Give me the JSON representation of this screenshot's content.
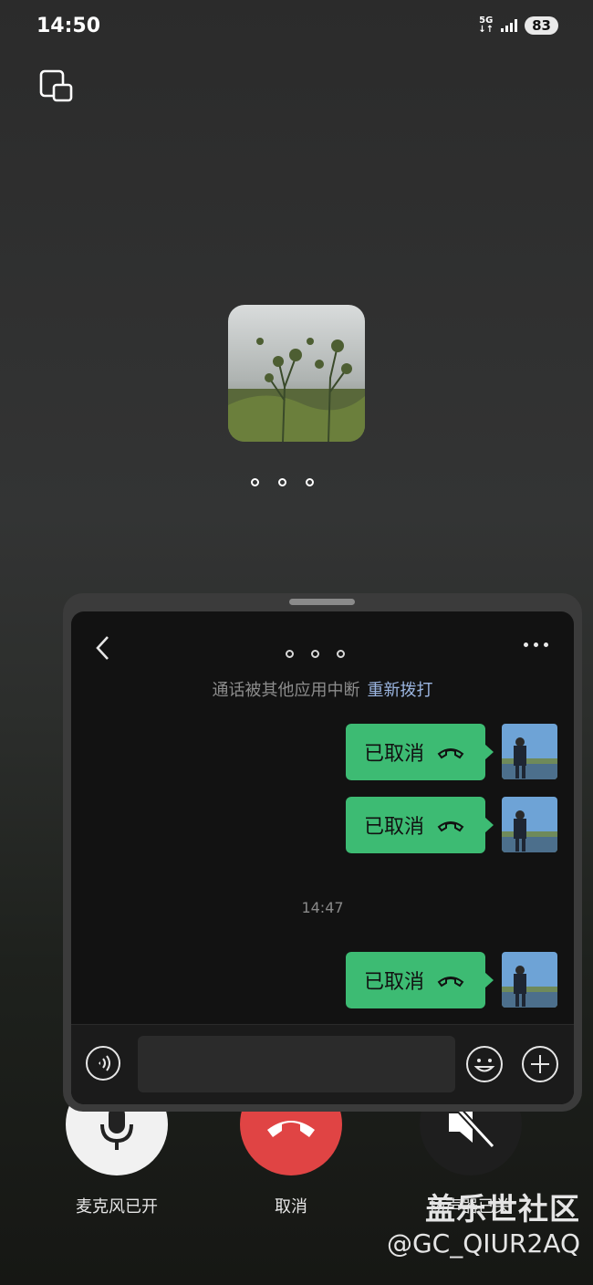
{
  "status_bar": {
    "time": "14:50",
    "network": "5G",
    "battery": "83"
  },
  "call": {
    "status_dots": "○ ○ ○"
  },
  "controls": {
    "mic_label": "麦克风已开",
    "hangup_label": "取消",
    "speaker_label": "扬声器已关"
  },
  "chat": {
    "system_message": "通话被其他应用中断",
    "redial_label": "重新拨打",
    "messages": [
      {
        "text": "已取消"
      },
      {
        "text": "已取消"
      },
      {
        "text": "已取消"
      }
    ],
    "timestamp": "14:47",
    "input_placeholder": ""
  },
  "watermark": {
    "line1": "盖乐世社区",
    "line2": "@GC_QIUR2AQ"
  },
  "colors": {
    "bubble": "#3dbb73",
    "hangup": "#e04444",
    "link": "#9bb5e0"
  }
}
